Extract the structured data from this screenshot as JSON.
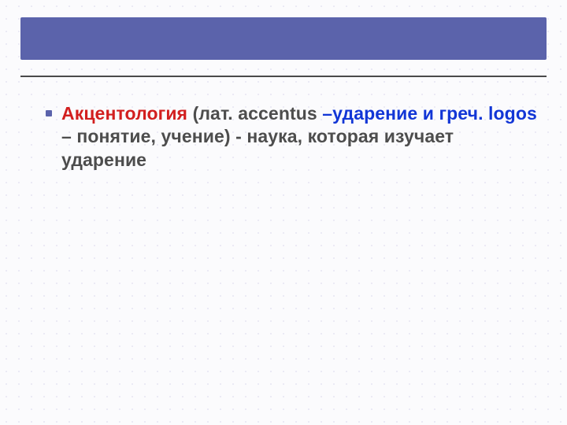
{
  "colors": {
    "accent_bar": "#5b63ab",
    "rule": "#4a4a4a",
    "text_default": "#4d4d4d",
    "text_red": "#d21f1f",
    "text_blue": "#1236d6"
  },
  "content": {
    "bullets": [
      {
        "segments": {
          "s1": "Акцентология ",
          "s2": "(лат. accentus ",
          "s3": "–ударение и греч. logos ",
          "s4": "– понятие, учение) - наука, которая изучает ударение"
        }
      }
    ]
  }
}
